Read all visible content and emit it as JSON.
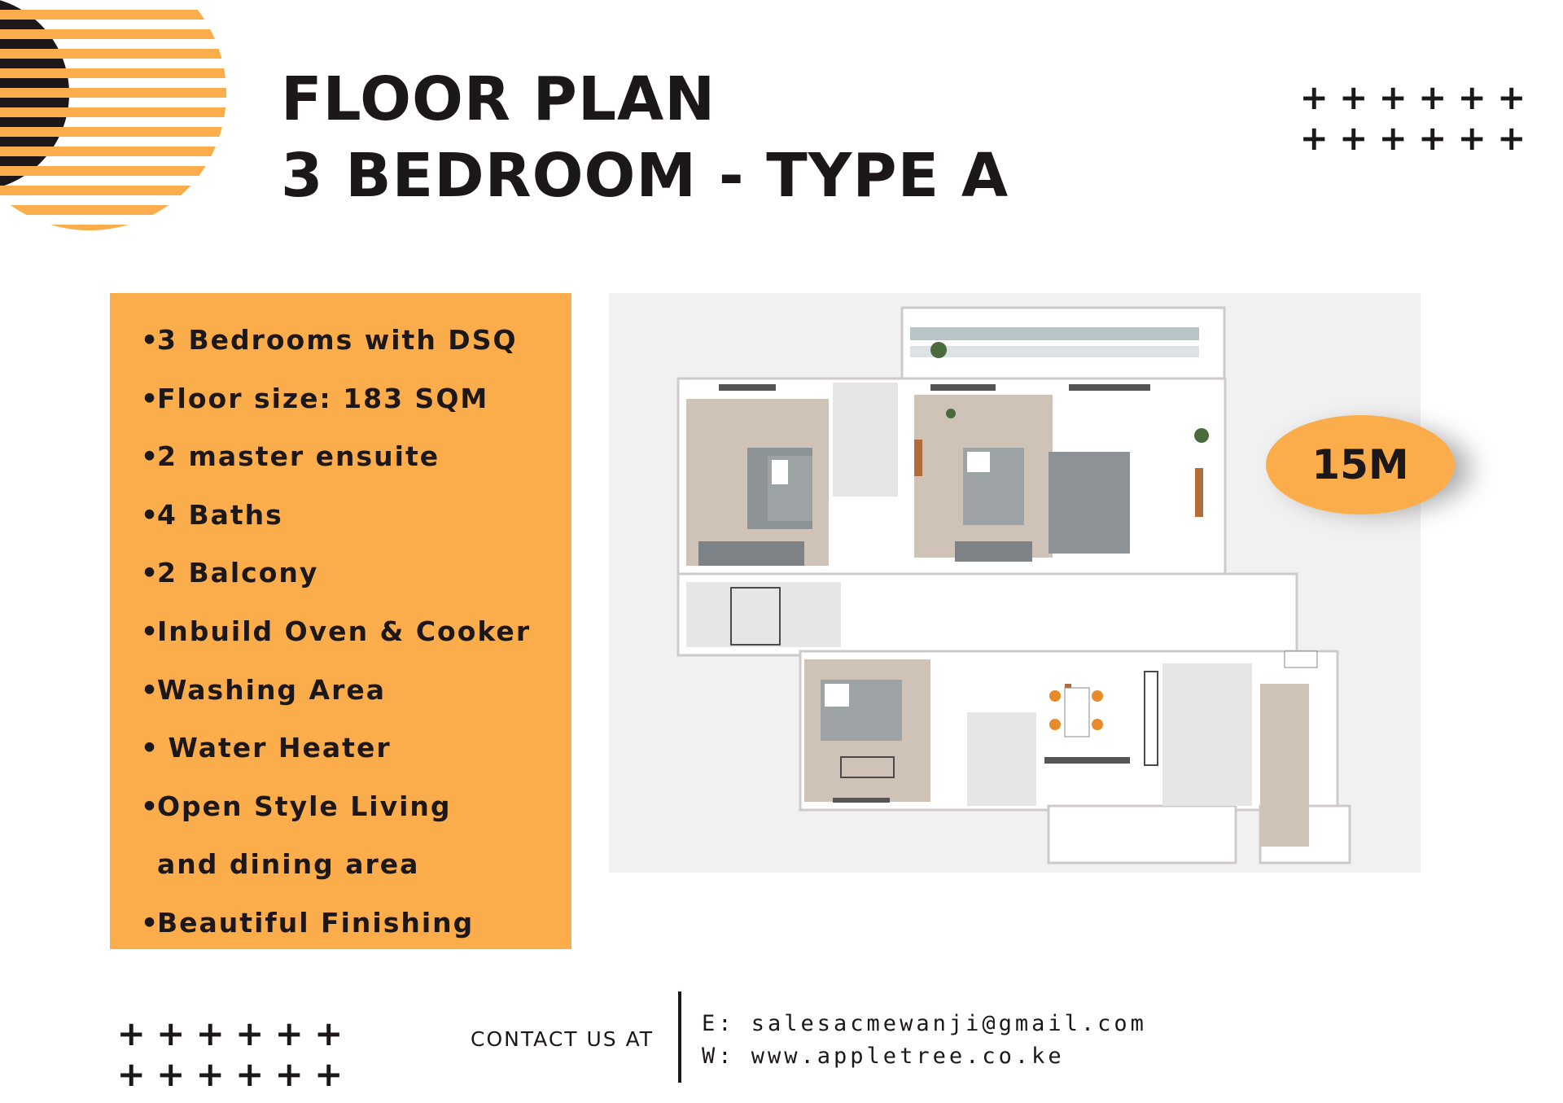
{
  "title": {
    "line1": "FLOOR PLAN",
    "line2": "3 BEDROOM - TYPE A"
  },
  "features": [
    {
      "bullet": "•",
      "text": "3 Bedrooms with DSQ"
    },
    {
      "bullet": "•",
      "text": "Floor size: 183 SQM"
    },
    {
      "bullet": "•",
      "text": "2 master ensuite"
    },
    {
      "bullet": "•",
      "text": "4 Baths"
    },
    {
      "bullet": "•",
      "text": "2 Balcony"
    },
    {
      "bullet": "•",
      "text": "Inbuild Oven & Cooker"
    },
    {
      "bullet": "•",
      "text": "Washing Area"
    },
    {
      "bullet": "•",
      "text": " Water Heater"
    },
    {
      "bullet": "•",
      "text": "Open Style Living"
    },
    {
      "bullet": "",
      "text": "and dining area"
    },
    {
      "bullet": "•",
      "text": "Beautiful Finishing"
    }
  ],
  "price": "15M",
  "contact": {
    "label": "CONTACT US AT",
    "email": "E: salesacmewanji@gmail.com",
    "website": "W: www.appletree.co.ke"
  },
  "colors": {
    "accent": "#fbad4c",
    "text": "#1c1718",
    "background": "#ffffff"
  },
  "icons": {
    "plus": "+",
    "decoration": "striped-half-circle"
  }
}
